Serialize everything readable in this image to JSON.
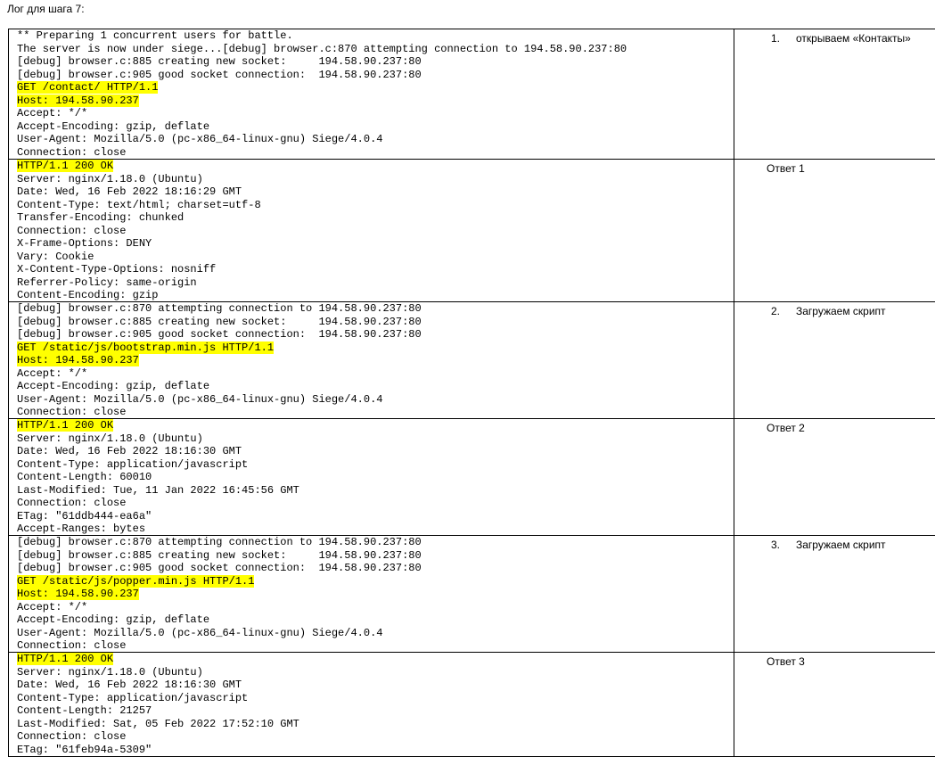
{
  "doc_title": "Лог для шага 7:",
  "rows": [
    {
      "note": "1.\topen",
      "note_num": "1.",
      "note_label": "открываем «Контакты»",
      "lines": [
        {
          "t": "** Preparing 1 concurrent users for battle.",
          "hl": false
        },
        {
          "t": "The server is now under siege...[debug] browser.c:870 attempting connection to 194.58.90.237:80",
          "hl": false
        },
        {
          "t": "[debug] browser.c:885 creating new socket:     194.58.90.237:80",
          "hl": false
        },
        {
          "t": "[debug] browser.c:905 good socket connection:  194.58.90.237:80",
          "hl": false
        },
        {
          "t": "GET /contact/ HTTP/1.1",
          "hl": true
        },
        {
          "t": "Host: 194.58.90.237",
          "hl": true
        },
        {
          "t": "Accept: */*",
          "hl": false
        },
        {
          "t": "Accept-Encoding: gzip, deflate",
          "hl": false
        },
        {
          "t": "User-Agent: Mozilla/5.0 (pc-x86_64-linux-gnu) Siege/4.0.4",
          "hl": false
        },
        {
          "t": "Connection: close",
          "hl": false
        }
      ]
    },
    {
      "note_num": "",
      "note_label": "Ответ 1",
      "lines": [
        {
          "t": "HTTP/1.1 200 OK",
          "hl": true
        },
        {
          "t": "Server: nginx/1.18.0 (Ubuntu)",
          "hl": false
        },
        {
          "t": "Date: Wed, 16 Feb 2022 18:16:29 GMT",
          "hl": false
        },
        {
          "t": "Content-Type: text/html; charset=utf-8",
          "hl": false
        },
        {
          "t": "Transfer-Encoding: chunked",
          "hl": false
        },
        {
          "t": "Connection: close",
          "hl": false
        },
        {
          "t": "X-Frame-Options: DENY",
          "hl": false
        },
        {
          "t": "Vary: Cookie",
          "hl": false
        },
        {
          "t": "X-Content-Type-Options: nosniff",
          "hl": false
        },
        {
          "t": "Referrer-Policy: same-origin",
          "hl": false
        },
        {
          "t": "Content-Encoding: gzip",
          "hl": false
        }
      ]
    },
    {
      "note_num": "2.",
      "note_label": "Загружаем скрипт",
      "lines": [
        {
          "t": "[debug] browser.c:870 attempting connection to 194.58.90.237:80",
          "hl": false
        },
        {
          "t": "[debug] browser.c:885 creating new socket:     194.58.90.237:80",
          "hl": false
        },
        {
          "t": "[debug] browser.c:905 good socket connection:  194.58.90.237:80",
          "hl": false
        },
        {
          "t": "GET /static/js/bootstrap.min.js HTTP/1.1",
          "hl": true
        },
        {
          "t": "Host: 194.58.90.237",
          "hl": true
        },
        {
          "t": "Accept: */*",
          "hl": false
        },
        {
          "t": "Accept-Encoding: gzip, deflate",
          "hl": false
        },
        {
          "t": "User-Agent: Mozilla/5.0 (pc-x86_64-linux-gnu) Siege/4.0.4",
          "hl": false
        },
        {
          "t": "Connection: close",
          "hl": false
        }
      ]
    },
    {
      "note_num": "",
      "note_label": "Ответ 2",
      "lines": [
        {
          "t": "HTTP/1.1 200 OK",
          "hl": true
        },
        {
          "t": "Server: nginx/1.18.0 (Ubuntu)",
          "hl": false
        },
        {
          "t": "Date: Wed, 16 Feb 2022 18:16:30 GMT",
          "hl": false
        },
        {
          "t": "Content-Type: application/javascript",
          "hl": false
        },
        {
          "t": "Content-Length: 60010",
          "hl": false
        },
        {
          "t": "Last-Modified: Tue, 11 Jan 2022 16:45:56 GMT",
          "hl": false
        },
        {
          "t": "Connection: close",
          "hl": false
        },
        {
          "t": "ETag: \"61ddb444-ea6a\"",
          "hl": false
        },
        {
          "t": "Accept-Ranges: bytes",
          "hl": false
        }
      ]
    },
    {
      "note_num": "3.",
      "note_label": "Загружаем скрипт",
      "lines": [
        {
          "t": "[debug] browser.c:870 attempting connection to 194.58.90.237:80",
          "hl": false
        },
        {
          "t": "[debug] browser.c:885 creating new socket:     194.58.90.237:80",
          "hl": false
        },
        {
          "t": "[debug] browser.c:905 good socket connection:  194.58.90.237:80",
          "hl": false
        },
        {
          "t": "GET /static/js/popper.min.js HTTP/1.1",
          "hl": true
        },
        {
          "t": "Host: 194.58.90.237",
          "hl": true
        },
        {
          "t": "Accept: */*",
          "hl": false
        },
        {
          "t": "Accept-Encoding: gzip, deflate",
          "hl": false
        },
        {
          "t": "User-Agent: Mozilla/5.0 (pc-x86_64-linux-gnu) Siege/4.0.4",
          "hl": false
        },
        {
          "t": "Connection: close",
          "hl": false
        }
      ]
    },
    {
      "note_num": "",
      "note_label": "Ответ 3",
      "lines": [
        {
          "t": "HTTP/1.1 200 OK",
          "hl": true
        },
        {
          "t": "Server: nginx/1.18.0 (Ubuntu)",
          "hl": false
        },
        {
          "t": "Date: Wed, 16 Feb 2022 18:16:30 GMT",
          "hl": false
        },
        {
          "t": "Content-Type: application/javascript",
          "hl": false
        },
        {
          "t": "Content-Length: 21257",
          "hl": false
        },
        {
          "t": "Last-Modified: Sat, 05 Feb 2022 17:52:10 GMT",
          "hl": false
        },
        {
          "t": "Connection: close",
          "hl": false
        },
        {
          "t": "ETag: \"61feb94a-5309\"",
          "hl": false
        }
      ]
    }
  ]
}
